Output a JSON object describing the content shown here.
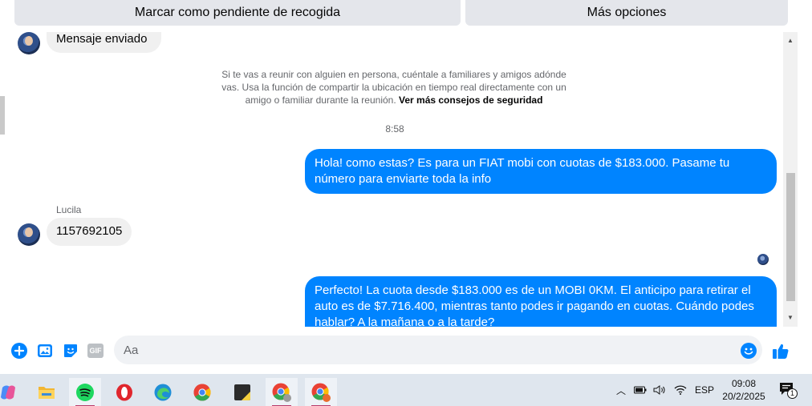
{
  "topbar": {
    "mark_pending_label": "Marcar como pendiente de recogida",
    "more_options_label": "Más opciones"
  },
  "chat": {
    "partial_sent_label": "Mensaje enviado",
    "safety_notice": "Si te vas a reunir con alguien en persona, cuéntale a familiares y amigos adónde vas. Usa la función de compartir la ubicación en tiempo real directamente con un amigo o familiar durante la reunión.",
    "safety_link": "Ver más consejos de seguridad",
    "timestamp": "8:58",
    "messages": [
      {
        "from": "me",
        "text": "Hola! como estas? Es para un FIAT mobi con cuotas de $183.000. Pasame tu número para enviarte toda la info"
      },
      {
        "from": "Lucila",
        "text": "1157692105"
      },
      {
        "from": "me",
        "text": "Perfecto! La cuota desde $183.000 es de un MOBI 0KM. El anticipo para retirar el auto es de $7.716.400, mientras tanto podes ir pagando en cuotas. Cuándo podes hablar? A la mañana o a la tarde?"
      }
    ],
    "sender_name": "Lucila"
  },
  "composer": {
    "placeholder": "Aa",
    "icons": [
      "plus-icon",
      "photo-icon",
      "sticker-icon",
      "gif-icon",
      "emoji-icon",
      "like-icon"
    ],
    "gif_label": "GIF"
  },
  "taskbar": {
    "apps": [
      "copilot",
      "file-explorer",
      "spotify",
      "opera",
      "edge",
      "chrome",
      "sticky-notes",
      "chrome-profile-1",
      "chrome-profile-2"
    ],
    "language": "ESP",
    "time": "09:08",
    "date": "20/2/2025",
    "notification_count": "1"
  },
  "colors": {
    "accent": "#0084ff",
    "bubble_in": "#f0f0f0",
    "button_bg": "#e4e6eb"
  }
}
